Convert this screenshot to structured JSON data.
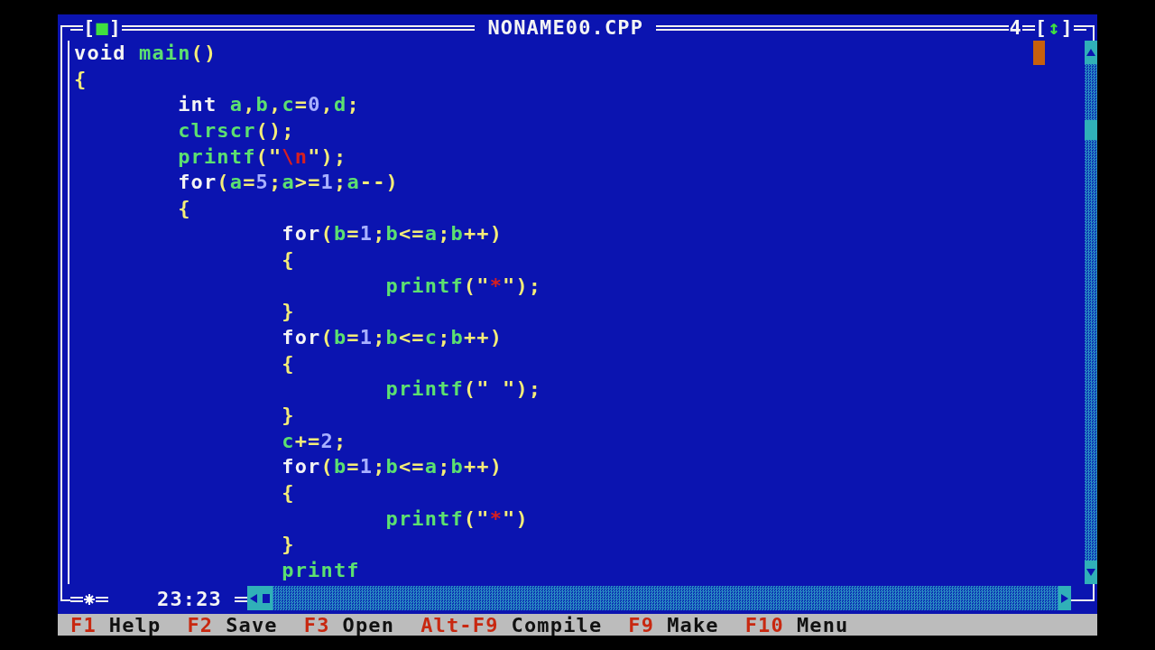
{
  "window": {
    "title": "NONAME00.CPP",
    "number": "4",
    "close_button": {
      "open": "[",
      "symbol": "■",
      "close": "]"
    },
    "zoom_button": {
      "open": "[",
      "symbol": "↕",
      "close": "]"
    }
  },
  "editor": {
    "lines": [
      {
        "tokens": [
          {
            "text": "void ",
            "kind": "keyword"
          },
          {
            "text": "main",
            "kind": "ident"
          },
          {
            "text": "()",
            "kind": "punct"
          }
        ]
      },
      {
        "tokens": [
          {
            "text": "{",
            "kind": "punct"
          }
        ]
      },
      {
        "tokens": [
          {
            "text": "        int ",
            "kind": "keyword"
          },
          {
            "text": "a",
            "kind": "ident"
          },
          {
            "text": ",",
            "kind": "punct"
          },
          {
            "text": "b",
            "kind": "ident"
          },
          {
            "text": ",",
            "kind": "punct"
          },
          {
            "text": "c",
            "kind": "ident"
          },
          {
            "text": "=",
            "kind": "punct"
          },
          {
            "text": "0",
            "kind": "number"
          },
          {
            "text": ",",
            "kind": "punct"
          },
          {
            "text": "d",
            "kind": "ident"
          },
          {
            "text": ";",
            "kind": "punct"
          }
        ]
      },
      {
        "tokens": [
          {
            "text": "        clrscr",
            "kind": "ident"
          },
          {
            "text": "();",
            "kind": "punct"
          }
        ]
      },
      {
        "tokens": [
          {
            "text": "        printf",
            "kind": "ident"
          },
          {
            "text": "(\"",
            "kind": "punct"
          },
          {
            "text": "\\n",
            "kind": "string"
          },
          {
            "text": "\");",
            "kind": "punct"
          }
        ]
      },
      {
        "tokens": [
          {
            "text": "        for",
            "kind": "keyword"
          },
          {
            "text": "(",
            "kind": "punct"
          },
          {
            "text": "a",
            "kind": "ident"
          },
          {
            "text": "=",
            "kind": "punct"
          },
          {
            "text": "5",
            "kind": "number"
          },
          {
            "text": ";",
            "kind": "punct"
          },
          {
            "text": "a",
            "kind": "ident"
          },
          {
            "text": ">=",
            "kind": "punct"
          },
          {
            "text": "1",
            "kind": "number"
          },
          {
            "text": ";",
            "kind": "punct"
          },
          {
            "text": "a",
            "kind": "ident"
          },
          {
            "text": "--)",
            "kind": "punct"
          }
        ]
      },
      {
        "tokens": [
          {
            "text": "        {",
            "kind": "punct"
          }
        ]
      },
      {
        "tokens": [
          {
            "text": "                for",
            "kind": "keyword"
          },
          {
            "text": "(",
            "kind": "punct"
          },
          {
            "text": "b",
            "kind": "ident"
          },
          {
            "text": "=",
            "kind": "punct"
          },
          {
            "text": "1",
            "kind": "number"
          },
          {
            "text": ";",
            "kind": "punct"
          },
          {
            "text": "b",
            "kind": "ident"
          },
          {
            "text": "<=",
            "kind": "punct"
          },
          {
            "text": "a",
            "kind": "ident"
          },
          {
            "text": ";",
            "kind": "punct"
          },
          {
            "text": "b",
            "kind": "ident"
          },
          {
            "text": "++)",
            "kind": "punct"
          }
        ]
      },
      {
        "tokens": [
          {
            "text": "                {",
            "kind": "punct"
          }
        ]
      },
      {
        "tokens": [
          {
            "text": "                        printf",
            "kind": "ident"
          },
          {
            "text": "(\"",
            "kind": "punct"
          },
          {
            "text": "*",
            "kind": "string"
          },
          {
            "text": "\");",
            "kind": "punct"
          }
        ]
      },
      {
        "tokens": [
          {
            "text": "                }",
            "kind": "punct"
          }
        ]
      },
      {
        "tokens": [
          {
            "text": "                for",
            "kind": "keyword"
          },
          {
            "text": "(",
            "kind": "punct"
          },
          {
            "text": "b",
            "kind": "ident"
          },
          {
            "text": "=",
            "kind": "punct"
          },
          {
            "text": "1",
            "kind": "number"
          },
          {
            "text": ";",
            "kind": "punct"
          },
          {
            "text": "b",
            "kind": "ident"
          },
          {
            "text": "<=",
            "kind": "punct"
          },
          {
            "text": "c",
            "kind": "ident"
          },
          {
            "text": ";",
            "kind": "punct"
          },
          {
            "text": "b",
            "kind": "ident"
          },
          {
            "text": "++)",
            "kind": "punct"
          }
        ]
      },
      {
        "tokens": [
          {
            "text": "                {",
            "kind": "punct"
          }
        ]
      },
      {
        "tokens": [
          {
            "text": "                        printf",
            "kind": "ident"
          },
          {
            "text": "(\" \");",
            "kind": "punct"
          }
        ]
      },
      {
        "tokens": [
          {
            "text": "                }",
            "kind": "punct"
          }
        ]
      },
      {
        "tokens": [
          {
            "text": "                c",
            "kind": "ident"
          },
          {
            "text": "+=",
            "kind": "punct"
          },
          {
            "text": "2",
            "kind": "number"
          },
          {
            "text": ";",
            "kind": "punct"
          }
        ]
      },
      {
        "tokens": [
          {
            "text": "                for",
            "kind": "keyword"
          },
          {
            "text": "(",
            "kind": "punct"
          },
          {
            "text": "b",
            "kind": "ident"
          },
          {
            "text": "=",
            "kind": "punct"
          },
          {
            "text": "1",
            "kind": "number"
          },
          {
            "text": ";",
            "kind": "punct"
          },
          {
            "text": "b",
            "kind": "ident"
          },
          {
            "text": "<=",
            "kind": "punct"
          },
          {
            "text": "a",
            "kind": "ident"
          },
          {
            "text": ";",
            "kind": "punct"
          },
          {
            "text": "b",
            "kind": "ident"
          },
          {
            "text": "++)",
            "kind": "punct"
          }
        ]
      },
      {
        "tokens": [
          {
            "text": "                {",
            "kind": "punct"
          }
        ]
      },
      {
        "tokens": [
          {
            "text": "                        printf",
            "kind": "ident"
          },
          {
            "text": "(\"",
            "kind": "punct"
          },
          {
            "text": "*",
            "kind": "string"
          },
          {
            "text": "\")",
            "kind": "punct"
          }
        ]
      },
      {
        "tokens": [
          {
            "text": "                }",
            "kind": "punct"
          }
        ]
      },
      {
        "tokens": [
          {
            "text": "                printf",
            "kind": "ident"
          }
        ]
      }
    ]
  },
  "status": {
    "modified": true,
    "position": "23:23"
  },
  "menu_bar": [
    {
      "key": "F1",
      "label": "Help"
    },
    {
      "key": "F2",
      "label": "Save"
    },
    {
      "key": "F3",
      "label": "Open"
    },
    {
      "key": "Alt-F9",
      "label": "Compile"
    },
    {
      "key": "F9",
      "label": "Make"
    },
    {
      "key": "F10",
      "label": "Menu"
    }
  ]
}
